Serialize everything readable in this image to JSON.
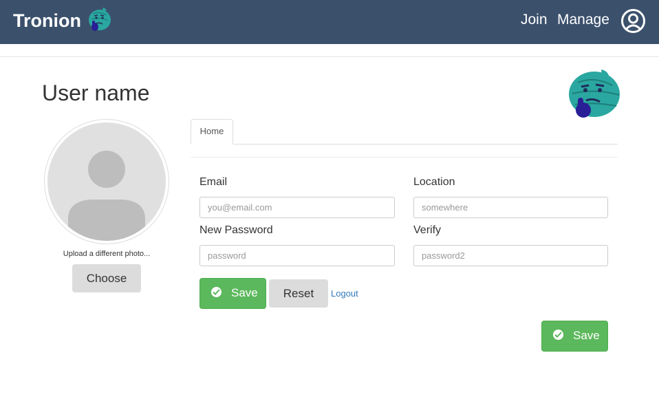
{
  "navbar": {
    "brand": "Tronion",
    "brand_icon": "tronion-logo-icon",
    "links": [
      "Join",
      "Manage"
    ],
    "account_icon": "account-circle-icon",
    "background": "#3b506b"
  },
  "profile": {
    "title": "User name",
    "avatar_icon": "user-placeholder-icon",
    "upload_label": "Upload a different photo...",
    "choose_label": "Choose"
  },
  "tabs": [
    {
      "label": "Home",
      "active": true
    }
  ],
  "form": {
    "email": {
      "label": "Email",
      "placeholder": "you@email.com",
      "value": ""
    },
    "location": {
      "label": "Location",
      "placeholder": "somewhere",
      "value": ""
    },
    "new_password": {
      "label": "New Password",
      "placeholder": "password",
      "value": ""
    },
    "verify": {
      "label": "Verify",
      "placeholder": "password2",
      "value": ""
    }
  },
  "actions": {
    "save_label": "Save",
    "reset_label": "Reset",
    "logout_label": "Logout",
    "save_bottom_label": "Save"
  },
  "colors": {
    "success": "#5cb85c",
    "link": "#337ab7",
    "logo_teal": "#2aa7a0",
    "logo_hand": "#2a1f96"
  }
}
